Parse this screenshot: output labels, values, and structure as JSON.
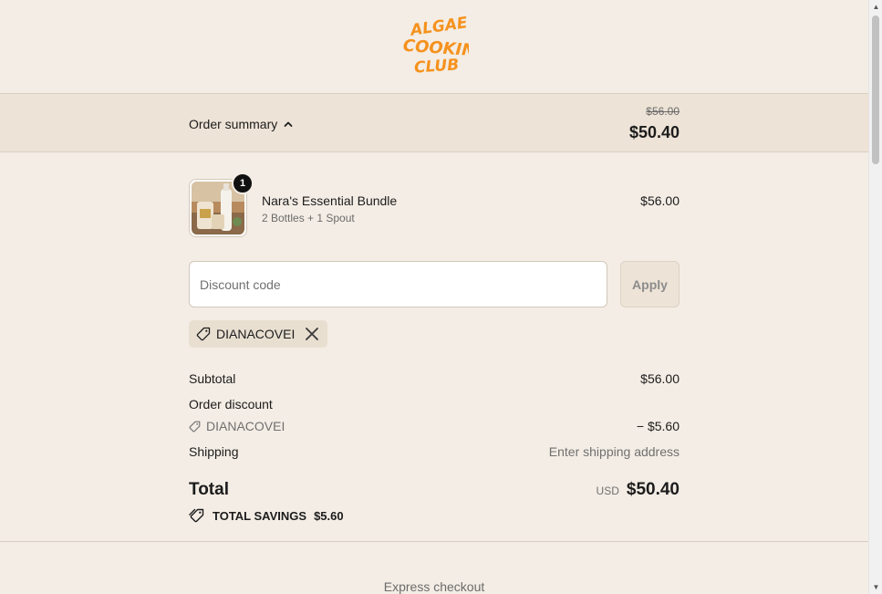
{
  "brand": {
    "logo_text": "ALGAE COOKING CLUB",
    "logo_color": "#f5921e"
  },
  "summary": {
    "toggle_label": "Order summary",
    "original_total": "$56.00",
    "total": "$50.40"
  },
  "product": {
    "quantity": "1",
    "name": "Nara's Essential Bundle",
    "variant": "2 Bottles + 1 Spout",
    "price": "$56.00"
  },
  "discount": {
    "placeholder": "Discount code",
    "value": "",
    "apply_label": "Apply",
    "applied_code": "DIANACOVEI"
  },
  "costs": {
    "subtotal_label": "Subtotal",
    "subtotal_value": "$56.00",
    "order_discount_label": "Order discount",
    "discount_code": "DIANACOVEI",
    "discount_value": "− $5.60",
    "shipping_label": "Shipping",
    "shipping_value": "Enter shipping address",
    "total_label": "Total",
    "currency": "USD",
    "total_value": "$50.40",
    "savings_label": "TOTAL SAVINGS",
    "savings_value": "$5.60"
  },
  "express": {
    "label": "Express checkout"
  }
}
